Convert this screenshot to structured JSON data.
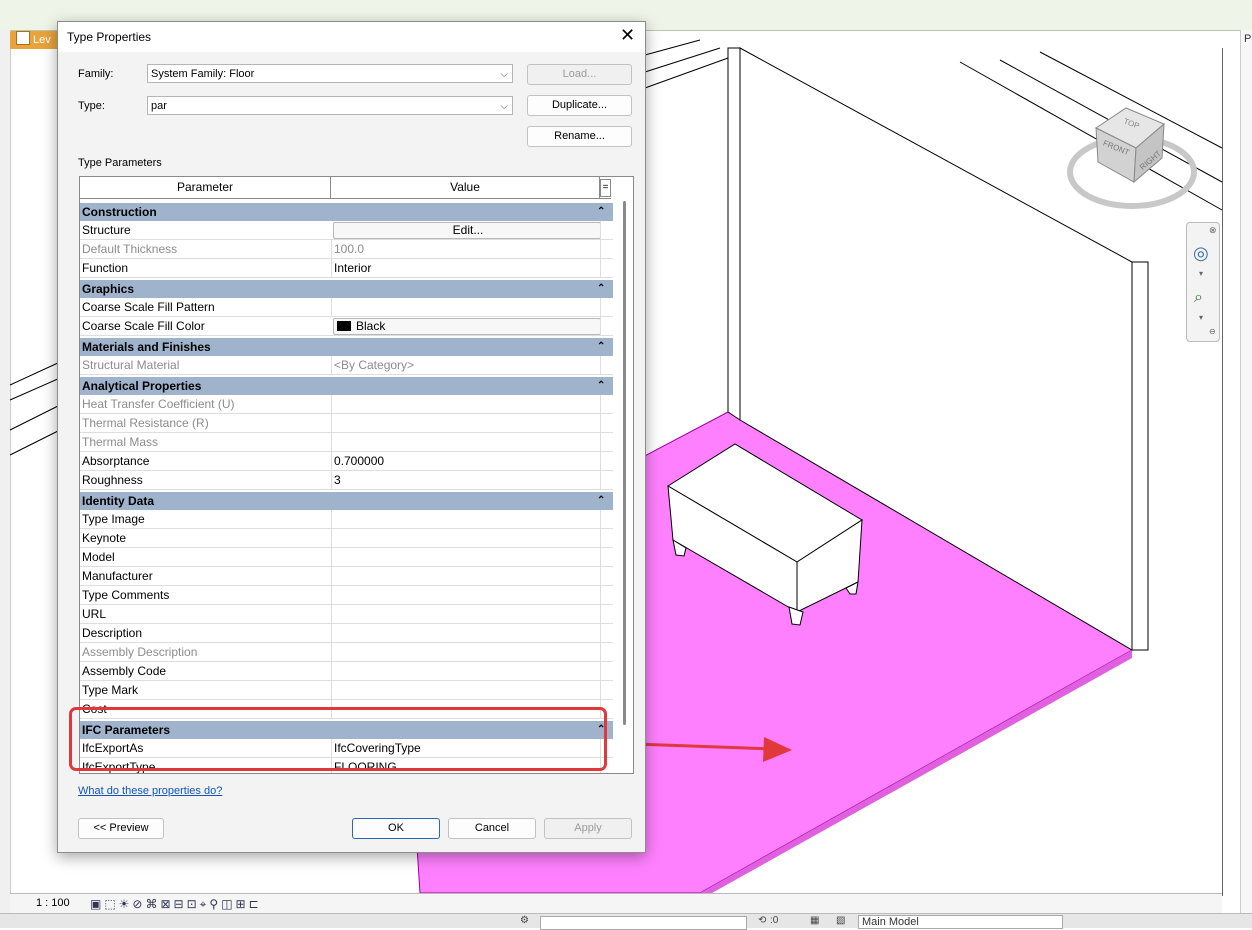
{
  "view_tab": {
    "label": "Lev"
  },
  "right_panel": {
    "label": "P"
  },
  "status": {
    "scale": "1 : 100",
    "icons": [
      "view-icon",
      "cube-icon",
      "sun-icon",
      "shadow-icon",
      "crop-icon",
      "hide-icon",
      "temp-hide-icon",
      "reveal-icon",
      "lock-icon",
      "analytics-icon",
      "highlight-icon",
      "constraints-icon",
      "display-icon"
    ]
  },
  "bottom": {
    "model": "Main Model",
    "count": ":0"
  },
  "viewcube": {
    "top": "TOP",
    "front": "FRONT",
    "right": "RIGHT"
  },
  "dialog": {
    "title": "Type Properties",
    "family_label": "Family:",
    "family_value": "System Family: Floor",
    "type_label": "Type:",
    "type_value": "par",
    "load_button": "Load...",
    "duplicate_button": "Duplicate...",
    "rename_button": "Rename...",
    "type_parameters_label": "Type Parameters",
    "columns": {
      "parameter": "Parameter",
      "value": "Value",
      "eq": "="
    },
    "help_link": "What do these properties do?",
    "preview_button": "<< Preview",
    "ok_button": "OK",
    "cancel_button": "Cancel",
    "apply_button": "Apply"
  },
  "groups": [
    {
      "name": "Construction",
      "rows": [
        {
          "p": "Structure",
          "v": "Edit...",
          "kind": "button"
        },
        {
          "p": "Default Thickness",
          "v": "100.0",
          "dim": true
        },
        {
          "p": "Function",
          "v": "Interior"
        }
      ]
    },
    {
      "name": "Graphics",
      "rows": [
        {
          "p": "Coarse Scale Fill Pattern",
          "v": ""
        },
        {
          "p": "Coarse Scale Fill Color",
          "v": "Black",
          "kind": "color"
        }
      ]
    },
    {
      "name": "Materials and Finishes",
      "rows": [
        {
          "p": "Structural Material",
          "v": "<By Category>",
          "dim": true
        }
      ]
    },
    {
      "name": "Analytical Properties",
      "rows": [
        {
          "p": "Heat Transfer Coefficient (U)",
          "v": "",
          "dim": true
        },
        {
          "p": "Thermal Resistance (R)",
          "v": "",
          "dim": true
        },
        {
          "p": "Thermal Mass",
          "v": "",
          "dim": true
        },
        {
          "p": "Absorptance",
          "v": "0.700000"
        },
        {
          "p": "Roughness",
          "v": "3"
        }
      ]
    },
    {
      "name": "Identity Data",
      "rows": [
        {
          "p": "Type Image",
          "v": ""
        },
        {
          "p": "Keynote",
          "v": ""
        },
        {
          "p": "Model",
          "v": ""
        },
        {
          "p": "Manufacturer",
          "v": ""
        },
        {
          "p": "Type Comments",
          "v": ""
        },
        {
          "p": "URL",
          "v": ""
        },
        {
          "p": "Description",
          "v": ""
        },
        {
          "p": "Assembly Description",
          "v": "",
          "dim": true
        },
        {
          "p": "Assembly Code",
          "v": ""
        },
        {
          "p": "Type Mark",
          "v": ""
        },
        {
          "p": "Cost",
          "v": ""
        }
      ]
    },
    {
      "name": "IFC Parameters",
      "rows": [
        {
          "p": "IfcExportAs",
          "v": "IfcCoveringType"
        },
        {
          "p": "IfcExportType",
          "v": "FLOORING"
        }
      ]
    }
  ],
  "colors": {
    "floor": "#ff80ff",
    "group_header": "#9fb3cc",
    "annotation": "#e0383b",
    "link": "#1155bb"
  }
}
